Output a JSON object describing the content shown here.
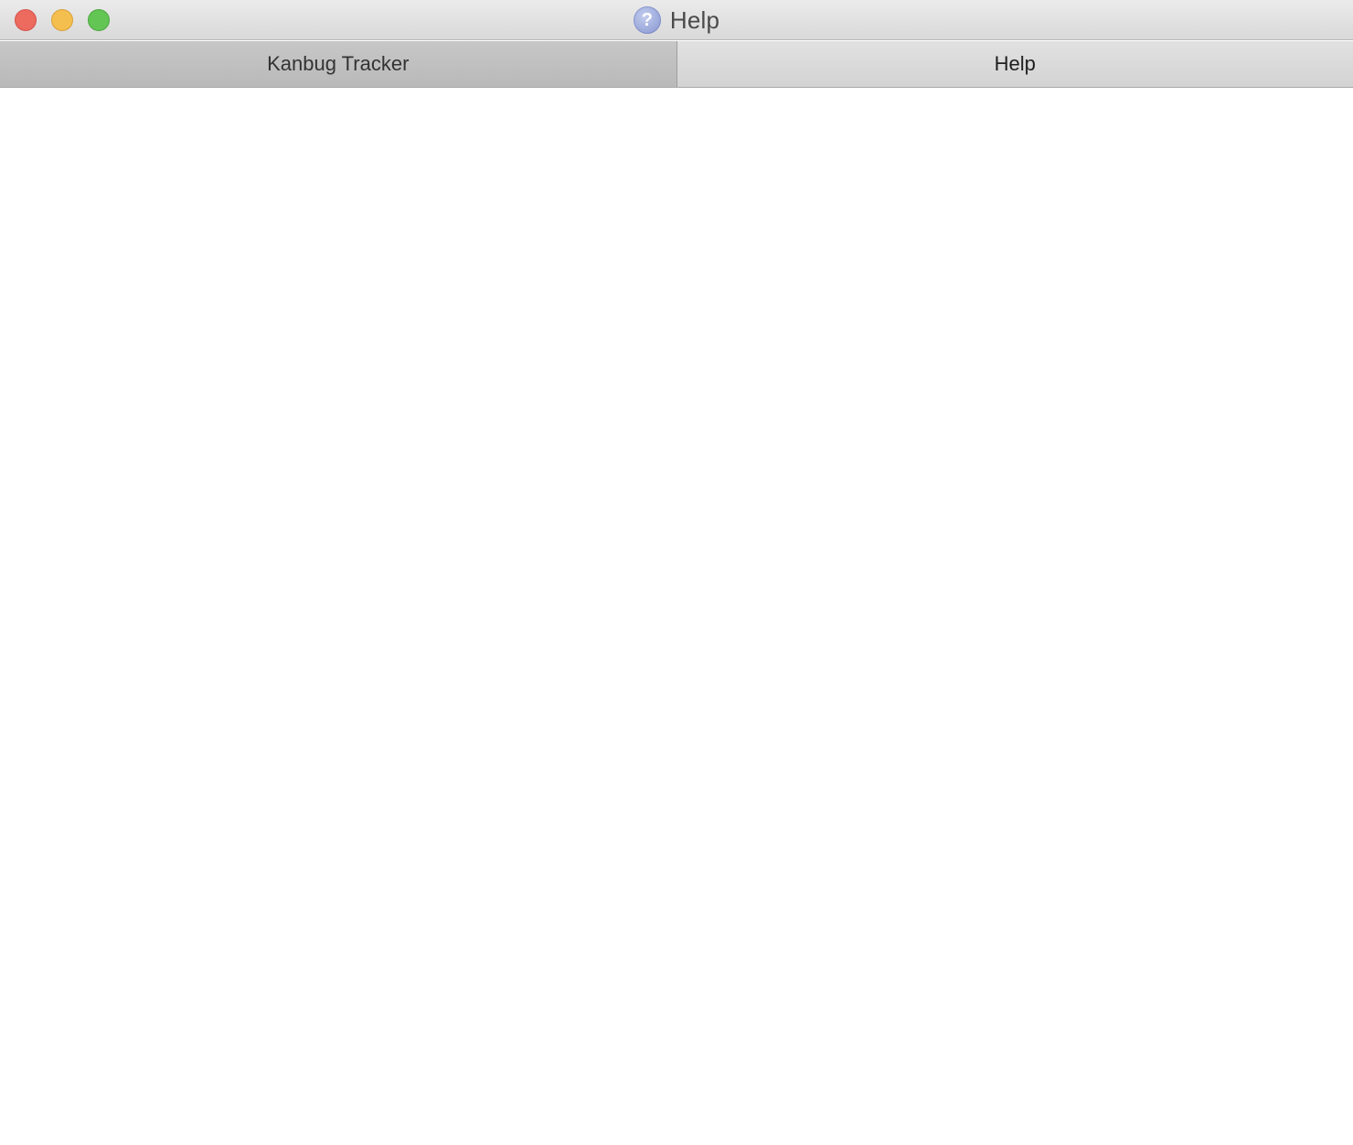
{
  "window": {
    "title": "Help",
    "title_icon": "question-mark-icon"
  },
  "traffic_lights": {
    "close": "#ed6a5e",
    "minimize": "#f5bf4f",
    "zoom": "#62c554"
  },
  "tabs": [
    {
      "label": "Kanbug Tracker",
      "selected": true
    },
    {
      "label": "Help",
      "selected": false
    }
  ]
}
